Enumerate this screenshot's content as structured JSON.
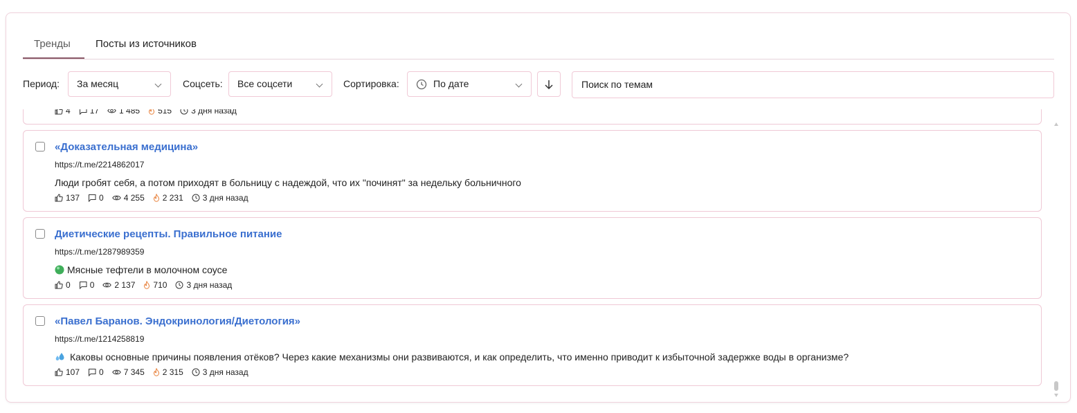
{
  "tabs": [
    {
      "label": "Тренды",
      "active": true
    },
    {
      "label": "Посты из источников",
      "active": false
    }
  ],
  "filters": {
    "period_label": "Период:",
    "period_value": "За месяц",
    "network_label": "Соцсеть:",
    "network_value": "Все соцсети",
    "sort_label": "Сортировка:",
    "sort_value": "По дате",
    "search_placeholder": "Поиск по темам"
  },
  "posts": [
    {
      "title": "",
      "url": "",
      "text": "",
      "likes": "4",
      "comments": "17",
      "views": "1 485",
      "reactions": "515",
      "time": "3 дня назад"
    },
    {
      "title": "«Доказательная медицина»",
      "url": "https://t.me/2214862017",
      "text": "Люди гробят себя, а потом приходят в больницу с надеждой, что их \"починят\" за недельку больничного",
      "likes": "137",
      "comments": "0",
      "views": "4 255",
      "reactions": "2 231",
      "time": "3 дня назад"
    },
    {
      "title": "Диетические рецепты. Правильное питание",
      "url": "https://t.me/1287989359",
      "text": "Мясные тефтели в молочном соусе",
      "likes": "0",
      "comments": "0",
      "views": "2 137",
      "reactions": "710",
      "time": "3 дня назад"
    },
    {
      "title": "«Павел Баранов. Эндокринология/Диетология»",
      "url": "https://t.me/1214258819",
      "text": "Каковы основные причины появления отёков? Через какие механизмы они развиваются, и как определить, что именно приводит к избыточной задержке воды в организме?",
      "likes": "107",
      "comments": "0",
      "views": "7 345",
      "reactions": "2 315",
      "time": "3 дня назад"
    }
  ],
  "colors": {
    "accent": "#3a6fcf",
    "border": "#efc8d5",
    "fire": "#e8803a"
  }
}
